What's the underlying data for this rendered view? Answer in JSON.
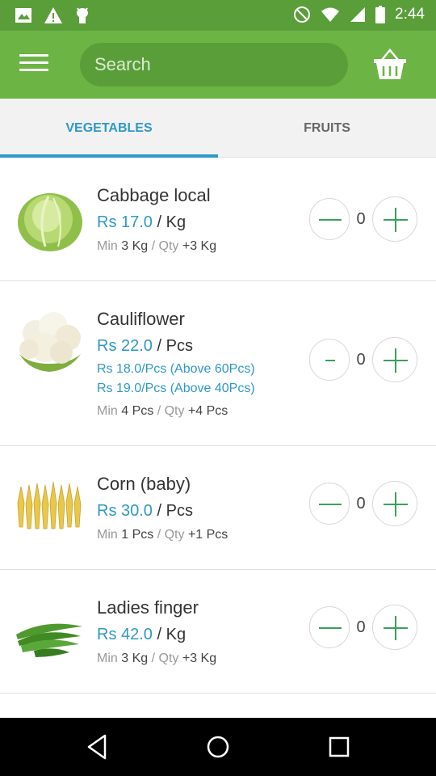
{
  "status_bar": {
    "time": "2:44",
    "icons": [
      "image-icon",
      "warning-icon",
      "android-icon",
      "do-not-disturb-icon",
      "wifi-icon",
      "signal-icon",
      "battery-icon"
    ]
  },
  "header": {
    "menu_icon": "hamburger-menu-icon",
    "search_placeholder": "Search",
    "cart_icon": "basket-icon"
  },
  "tabs": [
    {
      "label": "VEGETABLES",
      "active": true
    },
    {
      "label": "FRUITS",
      "active": false
    }
  ],
  "colors": {
    "status_bar": "#5a9e3a",
    "app_bar": "#6cb443",
    "accent_blue": "#2f98c9",
    "button_green": "#3aa05a"
  },
  "products": [
    {
      "name": "Cabbage local",
      "price": "Rs 17.0",
      "unit": "/ Kg",
      "tiers": [],
      "min_label": "Min",
      "min_value": "3 Kg",
      "qty_label": "/ Qty",
      "qty_step": "+3 Kg",
      "quantity": "0",
      "image": "cabbage-image"
    },
    {
      "name": "Cauliflower",
      "price": "Rs 22.0",
      "unit": "/ Pcs",
      "tiers": [
        "Rs 18.0/Pcs (Above 60Pcs)",
        "Rs 19.0/Pcs (Above 40Pcs)"
      ],
      "min_label": "Min",
      "min_value": "4 Pcs",
      "qty_label": "/ Qty",
      "qty_step": "+4 Pcs",
      "quantity": "0",
      "image": "cauliflower-image"
    },
    {
      "name": "Corn (baby)",
      "price": "Rs 30.0",
      "unit": "/ Pcs",
      "tiers": [],
      "min_label": "Min",
      "min_value": "1 Pcs",
      "qty_label": "/ Qty",
      "qty_step": "+1 Pcs",
      "quantity": "0",
      "image": "baby-corn-image"
    },
    {
      "name": "Ladies finger",
      "price": "Rs 42.0",
      "unit": "/ Kg",
      "tiers": [],
      "min_label": "Min",
      "min_value": "3 Kg",
      "qty_label": "/ Qty",
      "qty_step": "+3 Kg",
      "quantity": "0",
      "image": "okra-image"
    }
  ],
  "nav_bar": {
    "buttons": [
      "back-icon",
      "home-icon",
      "recents-icon"
    ]
  }
}
